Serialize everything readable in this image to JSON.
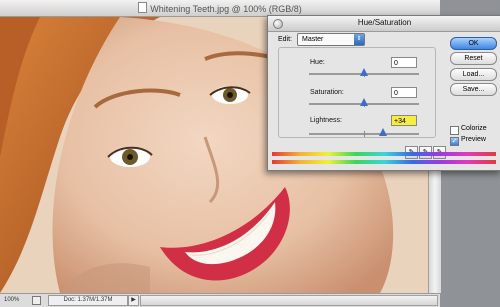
{
  "document": {
    "title": "Whitening Teeth.jpg @ 100% (RGB/8)",
    "zoom": "100%",
    "doc_size": "Doc: 1.37M/1.37M"
  },
  "dialog": {
    "title": "Hue/Saturation",
    "edit_label": "Edit:",
    "edit_value": "Master",
    "hue": {
      "label": "Hue:",
      "value": "0",
      "level": 0
    },
    "saturation": {
      "label": "Saturation:",
      "value": "0",
      "level": 0
    },
    "lightness": {
      "label": "Lightness:",
      "value": "+34",
      "level": 34
    },
    "buttons": {
      "ok": "OK",
      "reset": "Reset",
      "load": "Load...",
      "save": "Save..."
    },
    "colorize": {
      "label": "Colorize",
      "checked": false
    },
    "preview": {
      "label": "Preview",
      "checked": true
    }
  },
  "colors": {
    "accent_blue": "#3f86e0",
    "highlight_yellow": "#f6ee3a"
  }
}
